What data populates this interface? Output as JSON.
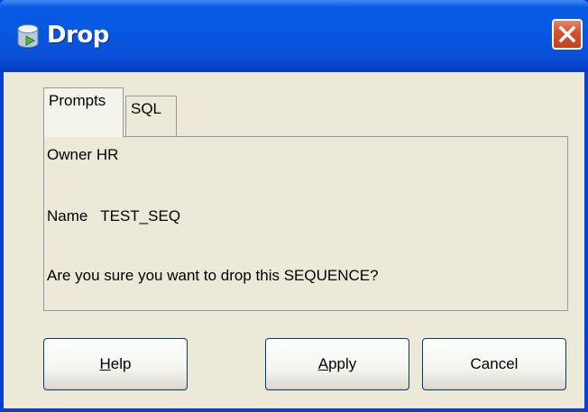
{
  "window": {
    "title": "Drop",
    "icon": "database-drop-icon",
    "close_icon": "close-x-icon"
  },
  "tabs": [
    {
      "label": "Prompts",
      "active": true
    },
    {
      "label": "SQL",
      "active": false
    }
  ],
  "prompts": {
    "owner_label": "Owner",
    "owner_value": "HR",
    "name_label": "Name",
    "name_value": "TEST_SEQ",
    "question": "Are you sure you want to drop this SEQUENCE?"
  },
  "buttons": {
    "help": {
      "mnemonic": "H",
      "rest": "elp"
    },
    "apply": {
      "mnemonic": "A",
      "rest": "pply"
    },
    "cancel": "Cancel"
  },
  "colors": {
    "titlebar": "#0658e0",
    "close_button": "#d5532f",
    "dialog_background": "#ece9d8",
    "border": "#919b9c"
  }
}
